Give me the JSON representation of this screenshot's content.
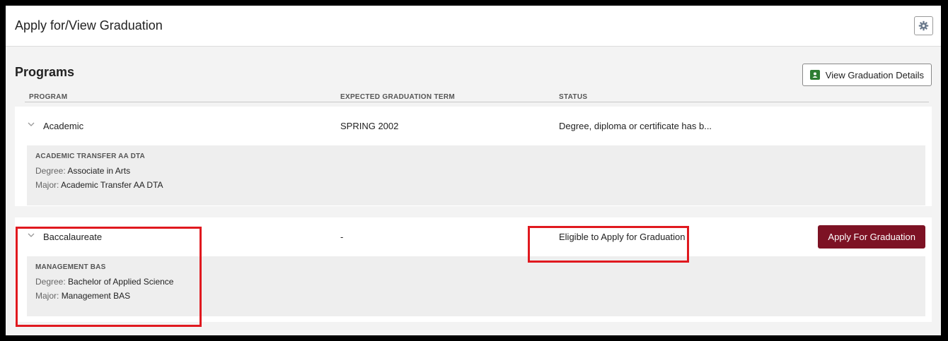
{
  "header": {
    "title": "Apply for/View Graduation",
    "settings_icon": "gear-icon"
  },
  "programs": {
    "title": "Programs",
    "details_button": "View Graduation Details",
    "columns": [
      "PROGRAM",
      "EXPECTED GRADUATION TERM",
      "STATUS"
    ],
    "items": [
      {
        "program": "Academic",
        "term": "SPRING 2002",
        "status": "Degree, diploma or certificate has b...",
        "detail": {
          "title": "ACADEMIC TRANSFER AA DTA",
          "degree_label": "Degree:",
          "degree": "Associate in Arts",
          "major_label": "Major:",
          "major": "Academic Transfer AA DTA"
        }
      },
      {
        "program": "Baccalaureate",
        "term": "-",
        "status": "Eligible to Apply for Graduation",
        "action": "Apply For Graduation",
        "detail": {
          "title": "MANAGEMENT BAS",
          "degree_label": "Degree:",
          "degree": "Bachelor of Applied Science",
          "major_label": "Major:",
          "major": "Management BAS"
        }
      }
    ]
  },
  "colors": {
    "accent": "#7d1224",
    "highlight": "#e0191f",
    "icon_green": "#2e7d32"
  }
}
